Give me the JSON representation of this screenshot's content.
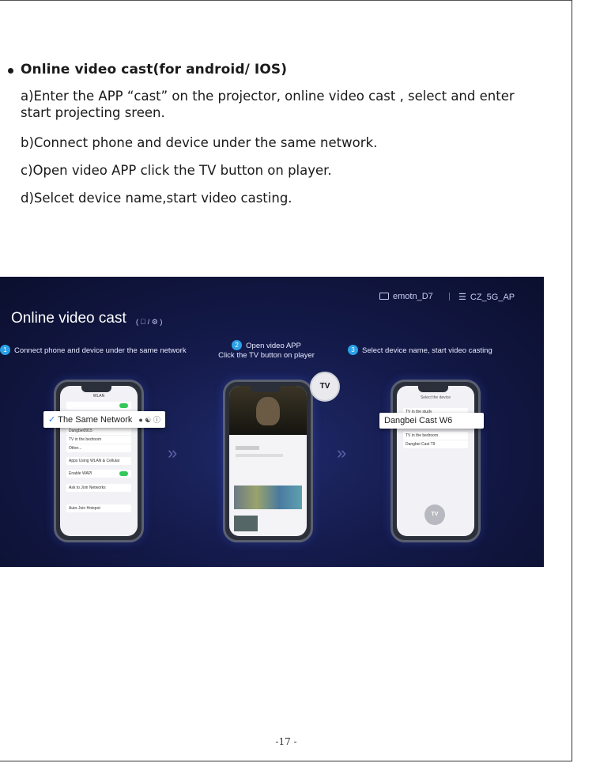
{
  "section": {
    "title": "Online video cast(for android/ IOS)",
    "steps": [
      "a)Enter the APP “cast” on the projector, online video cast , select and enter start projecting sreen.",
      "b)Connect phone and device under the same network.",
      "c)Open video APP click the TV button on player.",
      "d)Selcet device name,start video casting."
    ]
  },
  "banner": {
    "title": "Online video cast",
    "os_badge": "(  / ⚙ )",
    "status": {
      "device": "emotn_D7",
      "wifi": "CZ_5G_AP"
    },
    "columns": [
      {
        "num": "1",
        "text": "Connect phone and device under the same network"
      },
      {
        "num": "2",
        "line1": "Open video APP",
        "line2": "Click the TV button on player"
      },
      {
        "num": "3",
        "text": "Select device name, start video casting"
      }
    ],
    "phone1": {
      "header": "WLAN",
      "popup": "The Same Network",
      "rows": [
        "Dangbei0915",
        "TV in the bedroom",
        "Other...",
        "Apps Using WLAN & Cellular",
        "Enable WAPI",
        "Ask to Join Networks",
        "Auto-Join Hotspot"
      ]
    },
    "phone2": {
      "tv_label": "TV"
    },
    "phone3": {
      "header": "Select the device",
      "rows": [
        "TV in the study",
        "TV in the bedroom",
        "Dangbei Cast T9"
      ],
      "popup": "Dangbei Cast W6",
      "tv_label": "TV"
    },
    "colors": {
      "accent": "#2aa1e8",
      "bg": "#141a4a",
      "toggle": "#34c759"
    }
  },
  "footer": {
    "page": "-17 -"
  }
}
